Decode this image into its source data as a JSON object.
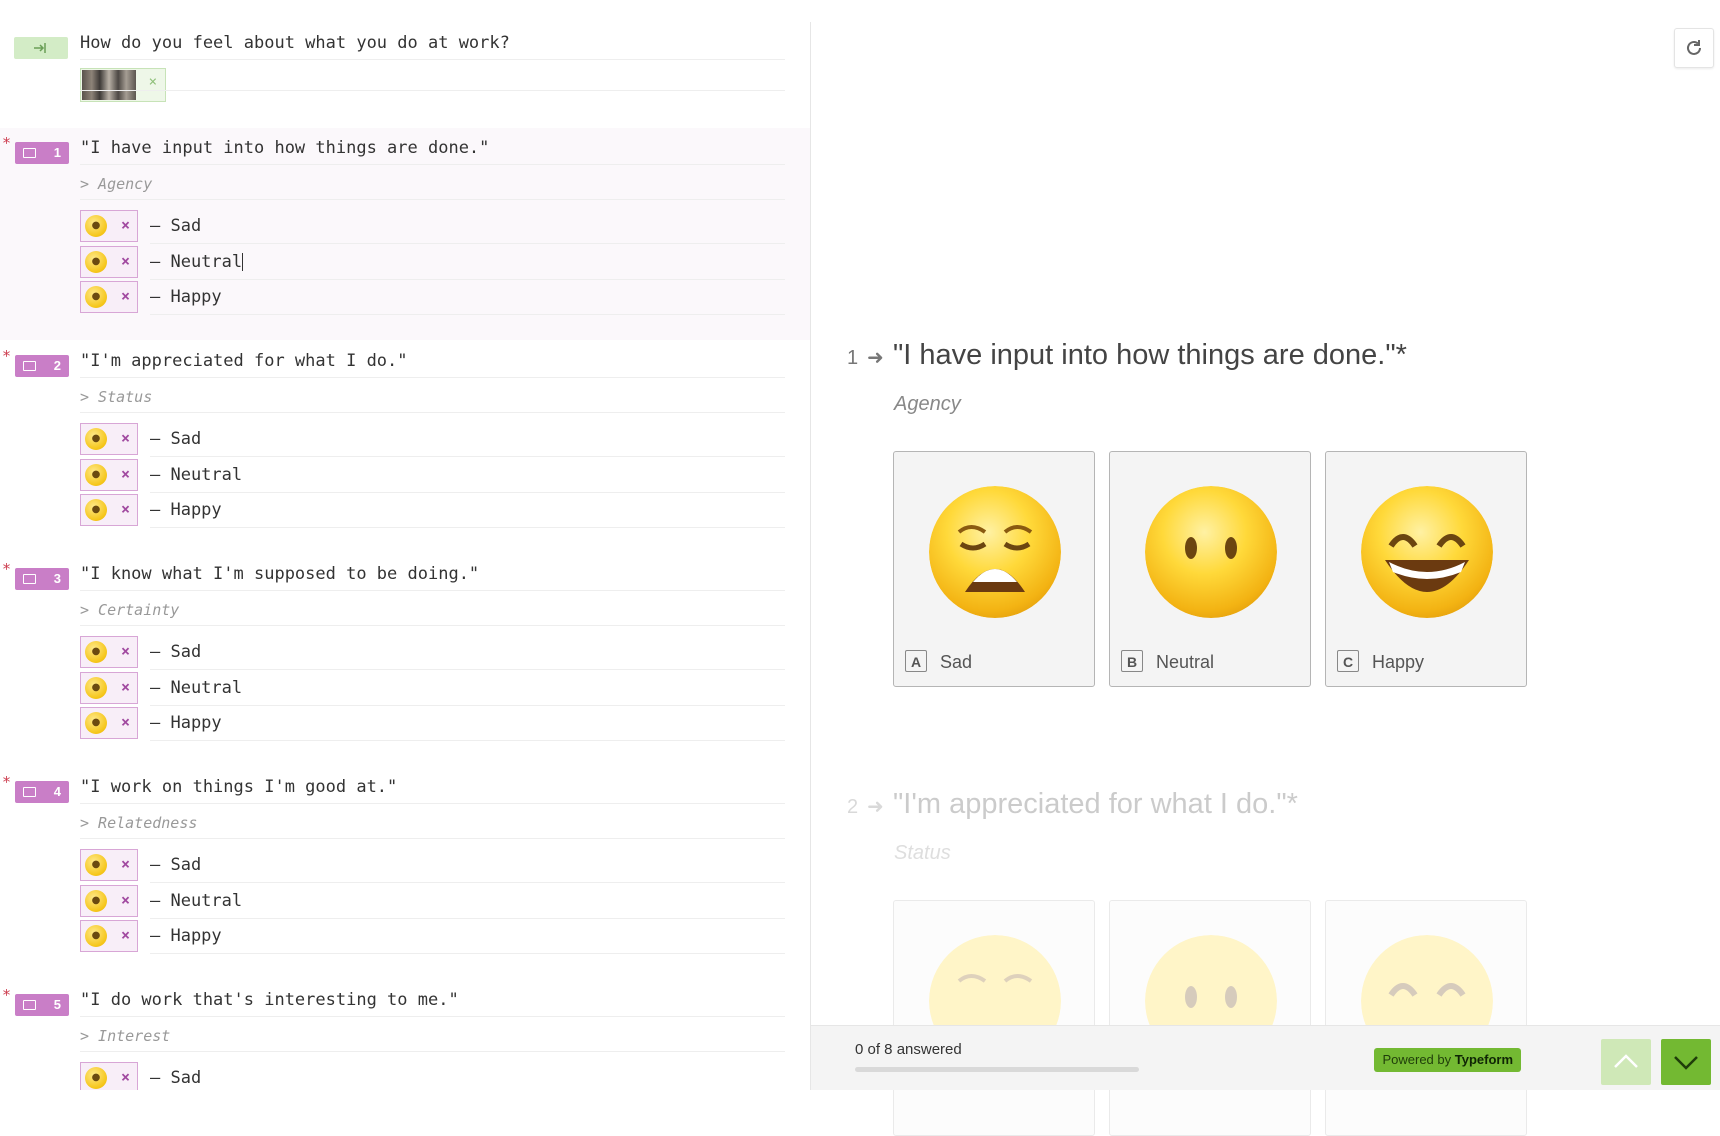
{
  "editor": {
    "intro_text": "How do you feel about what you do at work?",
    "thumb_close": "×",
    "questions": [
      {
        "num": "1",
        "text": "\"I have input into how things are done.\"",
        "category": "> Agency",
        "options": [
          {
            "emoji": "😩",
            "label": "– Sad"
          },
          {
            "emoji": "😶",
            "label": "– Neutral"
          },
          {
            "emoji": "😄",
            "label": "– Happy"
          }
        ]
      },
      {
        "num": "2",
        "text": "\"I'm appreciated for what I do.\"",
        "category": "> Status",
        "options": [
          {
            "emoji": "😩",
            "label": "– Sad"
          },
          {
            "emoji": "😶",
            "label": "– Neutral"
          },
          {
            "emoji": "😄",
            "label": "– Happy"
          }
        ]
      },
      {
        "num": "3",
        "text": "\"I know what I'm supposed to be doing.\"",
        "category": "> Certainty",
        "options": [
          {
            "emoji": "😩",
            "label": "– Sad"
          },
          {
            "emoji": "😶",
            "label": "– Neutral"
          },
          {
            "emoji": "😄",
            "label": "– Happy"
          }
        ]
      },
      {
        "num": "4",
        "text": "\"I work on things I'm good at.\"",
        "category": "> Relatedness",
        "options": [
          {
            "emoji": "😩",
            "label": "– Sad"
          },
          {
            "emoji": "😶",
            "label": "– Neutral"
          },
          {
            "emoji": "😄",
            "label": "– Happy"
          }
        ]
      },
      {
        "num": "5",
        "text": "\"I do work that's interesting to me.\"",
        "category": "> Interest",
        "options": [
          {
            "emoji": "😩",
            "label": "– Sad"
          }
        ]
      }
    ],
    "required_marker": "*",
    "remove_glyph": "×"
  },
  "preview": {
    "refresh_icon": "↻",
    "q1": {
      "num": "1",
      "arrow": "➜",
      "title": "\"I have input into how things are done.\"*",
      "description": "Agency",
      "choices": [
        {
          "key": "A",
          "label": "Sad",
          "face": "weary"
        },
        {
          "key": "B",
          "label": "Neutral",
          "face": "no-mouth"
        },
        {
          "key": "C",
          "label": "Happy",
          "face": "smile"
        }
      ]
    },
    "q2": {
      "num": "2",
      "arrow": "➜",
      "title": "\"I'm appreciated for what I do.\"*",
      "description": "Status"
    },
    "footer": {
      "progress_text": "0 of 8 answered",
      "progress_value": 0,
      "powered_prefix": "Powered by ",
      "powered_brand": "Typeform"
    }
  },
  "colors": {
    "accent_green": "#73b932",
    "question_tag": "#c97ec7",
    "intro_tag": "#d3ecc6",
    "required": "#cc3a4c"
  }
}
